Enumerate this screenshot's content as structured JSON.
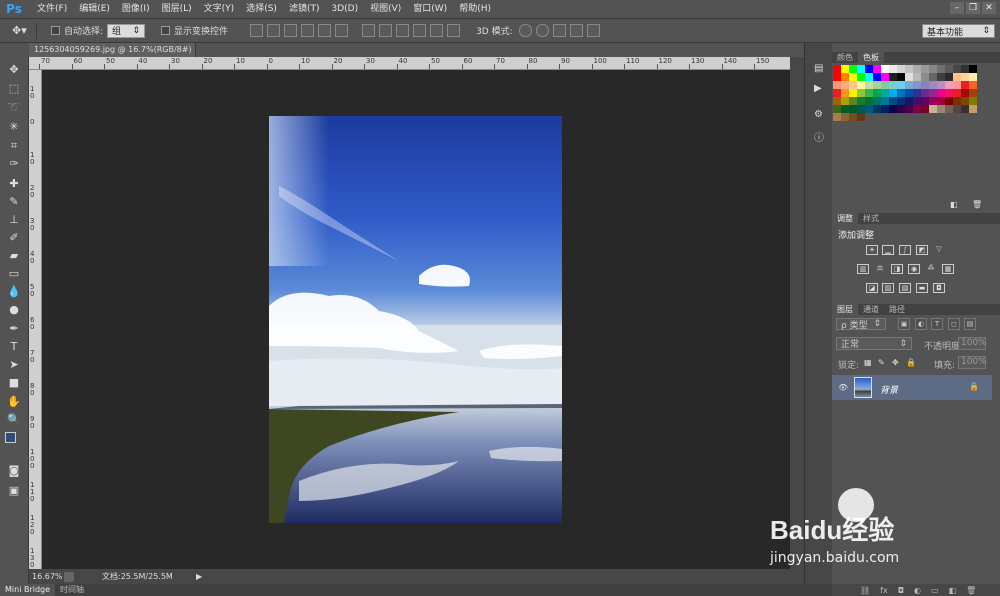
{
  "menubar": {
    "logo": "Ps",
    "items": [
      "文件(F)",
      "编辑(E)",
      "图像(I)",
      "图层(L)",
      "文字(Y)",
      "选择(S)",
      "滤镜(T)",
      "3D(D)",
      "视图(V)",
      "窗口(W)",
      "帮助(H)"
    ]
  },
  "options": {
    "auto_select_label": "自动选择:",
    "group_value": "组",
    "show_transform_label": "显示变换控件",
    "mode3d_label": "3D 模式:",
    "workspace": "基本功能"
  },
  "doc": {
    "tab_title": "1256304059269.jpg @ 16.7%(RGB/8#)",
    "close": "×"
  },
  "ruler": {
    "h_labels": [
      "70",
      "60",
      "50",
      "40",
      "30",
      "20",
      "10",
      "0",
      "10",
      "20",
      "30",
      "40",
      "50",
      "60",
      "70",
      "80",
      "90",
      "100",
      "110",
      "120",
      "130",
      "140",
      "150"
    ],
    "v_labels": [
      [
        "1",
        "0"
      ],
      [
        "0"
      ],
      [
        "1",
        "0"
      ],
      [
        "2",
        "0"
      ],
      [
        "3",
        "0"
      ],
      [
        "4",
        "0"
      ],
      [
        "5",
        "0"
      ],
      [
        "6",
        "0"
      ],
      [
        "7",
        "0"
      ],
      [
        "8",
        "0"
      ],
      [
        "9",
        "0"
      ],
      [
        "1",
        "0",
        "0"
      ],
      [
        "1",
        "1",
        "0"
      ],
      [
        "1",
        "2",
        "0"
      ],
      [
        "1",
        "3",
        "0"
      ]
    ]
  },
  "status": {
    "zoom": "16.67%",
    "doc_info": "文档:25.5M/25.5M"
  },
  "bottom_tabs": [
    "Mini Bridge",
    "时间轴"
  ],
  "swatch_panel": {
    "tabs": [
      "颜色",
      "色板"
    ],
    "active": 1
  },
  "adjust_panel": {
    "tabs": [
      "调整",
      "样式"
    ],
    "title": "添加调整"
  },
  "layers_panel": {
    "tabs": [
      "图层",
      "通道",
      "路径"
    ],
    "filter": "ρ 类型",
    "blend_mode": "正常",
    "opacity_label": "不透明度:",
    "opacity_value": "100%",
    "lock_label": "锁定:",
    "fill_label": "填充:",
    "fill_value": "100%",
    "layer_name": "背景"
  },
  "watermark": {
    "brand": "Baidu经验",
    "url": "jingyan.baidu.com"
  },
  "colors": {
    "accent": "#31a8ff",
    "canvas_bg": "#282828",
    "ui_bg": "#535353",
    "layer_sel": "#5d6b85"
  },
  "swatches": [
    "#ff0000",
    "#ffff00",
    "#00ff00",
    "#00ffff",
    "#0000ff",
    "#ff00ff",
    "#ffffff",
    "#ebebeb",
    "#d6d6d6",
    "#c2c2c2",
    "#adadad",
    "#999999",
    "#858585",
    "#707070",
    "#5c5c5c",
    "#474747",
    "#333333",
    "#000000",
    "#ff0000",
    "#ff7f00",
    "#ffff00",
    "#00ff00",
    "#00ffff",
    "#0000ff",
    "#ff00ff",
    "#1f1f1f",
    "#0a0a0a",
    "#e0e0e0",
    "#b8b8b8",
    "#8c8c8c",
    "#666666",
    "#404040",
    "#2b2b2b",
    "#ffc08a",
    "#ffd39a",
    "#ffeca8",
    "#f7977a",
    "#f9ad81",
    "#fdc68a",
    "#fff79a",
    "#c4df9b",
    "#a3d39c",
    "#82ca9d",
    "#7bcdc8",
    "#6ecff6",
    "#7ea7d8",
    "#8493ca",
    "#8882be",
    "#a187be",
    "#bc8dbf",
    "#f49ac2",
    "#f6989d",
    "#ed1c24",
    "#f26522",
    "#ed1c24",
    "#f7941d",
    "#fff200",
    "#8dc63f",
    "#39b54a",
    "#00a651",
    "#00a99d",
    "#00aeef",
    "#0072bc",
    "#0054a6",
    "#2e3192",
    "#662d91",
    "#92278f",
    "#ec008c",
    "#ed145b",
    "#ed1c24",
    "#9e0b0f",
    "#a0410d",
    "#a36209",
    "#aba000",
    "#598527",
    "#197b30",
    "#007236",
    "#00746b",
    "#0076a3",
    "#004b80",
    "#003471",
    "#1b1464",
    "#440e62",
    "#630460",
    "#9e005d",
    "#9e0039",
    "#790000",
    "#7b2e00",
    "#7d4900",
    "#827b00",
    "#406618",
    "#005e20",
    "#005826",
    "#005952",
    "#005b7f",
    "#003663",
    "#002157",
    "#0d004c",
    "#32004b",
    "#4b0049",
    "#7b0046",
    "#7a0026",
    "#c7b299",
    "#998675",
    "#736357",
    "#534741",
    "#37302d",
    "#c69c6d",
    "#a67c52",
    "#8c6239",
    "#754c24",
    "#603913"
  ]
}
